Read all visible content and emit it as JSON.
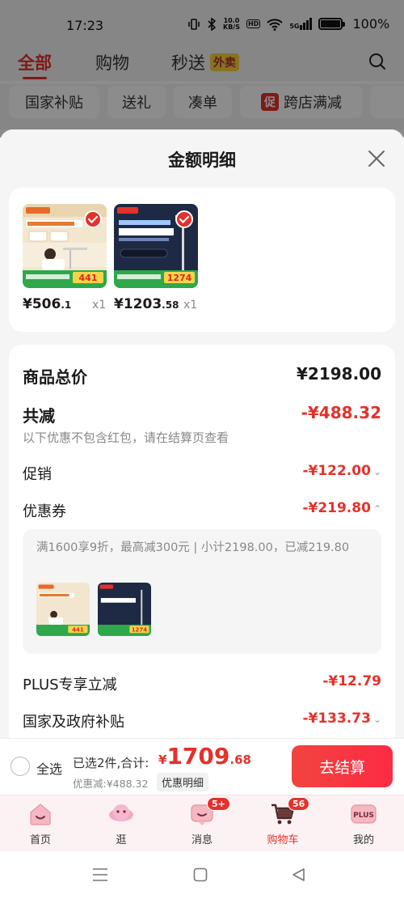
{
  "status_bar": {
    "time": "17:23",
    "net_speed_top": "10.0",
    "net_speed_bottom": "KB/S",
    "hd": "HD",
    "signal": "5G",
    "battery_percent": 1.0,
    "battery_text": "100%"
  },
  "top_nav": {
    "tabs": [
      "全部",
      "购物",
      "秒送"
    ],
    "active": "全部",
    "sec_badge": "外卖"
  },
  "chips": [
    {
      "label": "国家补贴"
    },
    {
      "label": "送礼"
    },
    {
      "label": "凑单"
    },
    {
      "tag": "促",
      "label": "跨店满减"
    }
  ],
  "sheet": {
    "title": "金额明细",
    "products": [
      {
        "price_int": "¥506",
        "price_dec": ".1",
        "qty": "x1",
        "thumb_price": "441"
      },
      {
        "price_int": "¥1203",
        "price_dec": ".58",
        "qty": "x1",
        "thumb_price": "1274"
      }
    ],
    "breakdown": {
      "total_label": "商品总价",
      "total_value": "¥2198.00",
      "reduce_label": "共减",
      "reduce_value": "-¥488.32",
      "reduce_note": "以下优惠不包含红包，请在结算页查看",
      "promo_label": "促销",
      "promo_value": "-¥122.00",
      "coupon_label": "优惠券",
      "coupon_value": "-¥219.80",
      "coupon_detail": "满1600享9折，最高减300元 | 小计2198.00，已减219.80",
      "plus_label": "PLUS专享立减",
      "plus_value": "-¥12.79",
      "gov_label": "国家及政府补贴",
      "gov_value": "-¥133.73"
    }
  },
  "checkout": {
    "select_all": "全选",
    "selected_text": "已选2件,合计:",
    "total_yen": "¥",
    "total_int": "1709",
    "total_dec": ".68",
    "discount_text": "优惠减:¥488.32",
    "detail_button": "优惠明细",
    "checkout_button": "去结算"
  },
  "tab_bar": {
    "items": [
      {
        "label": "首页"
      },
      {
        "label": "逛"
      },
      {
        "label": "消息",
        "badge": "5+"
      },
      {
        "label": "购物车",
        "badge": "56"
      },
      {
        "label": "我的",
        "icon_text": "PLUS"
      }
    ],
    "active": "购物车"
  },
  "colors": {
    "accent": "#e5312b",
    "checkout_button": "#f7333f",
    "tabbar_bg": "#fdf2f3"
  }
}
